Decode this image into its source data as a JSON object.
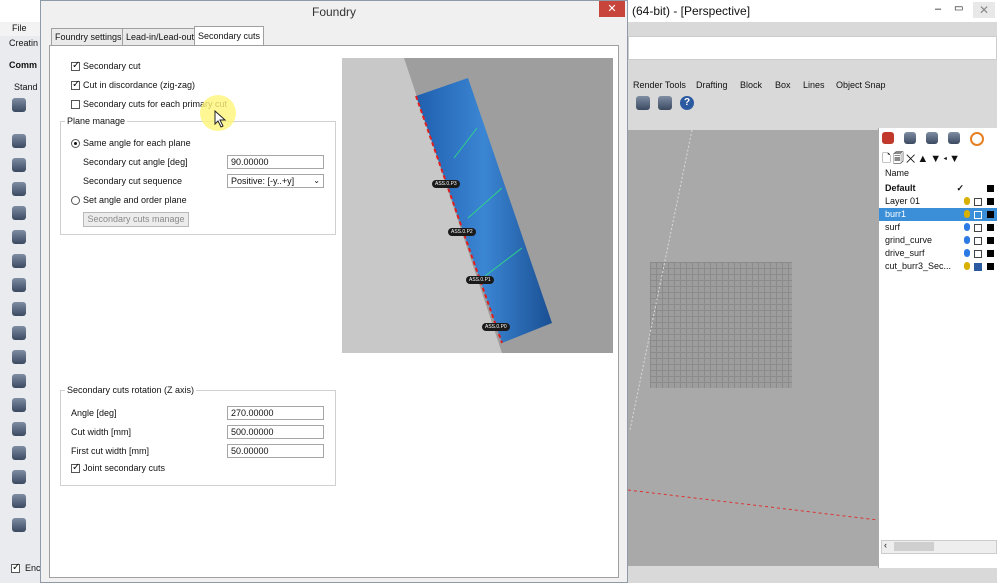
{
  "app": {
    "file_menu": "File",
    "left_truncated": [
      "Creatin",
      "Comm",
      "Stand",
      "Enc"
    ],
    "right_title": "(64-bit) - [Perspective]",
    "toolbar_tabs": [
      "Render Tools",
      "Drafting",
      "Block",
      "Box",
      "Lines",
      "Object Snap"
    ]
  },
  "layers": {
    "header": "Name",
    "items": [
      {
        "name": "Default",
        "checked": "✓",
        "color": "#000000"
      },
      {
        "name": "Layer 01",
        "color": "#000000"
      },
      {
        "name": "burr1",
        "color": "#000000",
        "selected": true
      },
      {
        "name": "surf",
        "color": "#000000"
      },
      {
        "name": "grind_curve",
        "color": "#000000"
      },
      {
        "name": "drive_surf",
        "color": "#000000"
      },
      {
        "name": "cut_burr3_Sec...",
        "color": "#000000"
      }
    ]
  },
  "dialog": {
    "title": "Foundry",
    "close": "✕",
    "tabs": [
      "Foundry settings",
      "Lead-in/Lead-out",
      "Secondary cuts"
    ],
    "options": {
      "secondary_cut": "Secondary cut",
      "cut_discordance": "Cut in discordance (zig-zag)",
      "cuts_each_primary": "Secondary cuts for each primary cut"
    },
    "plane_manage": {
      "title": "Plane manage",
      "same_angle": "Same angle for each plane",
      "angle_label": "Secondary cut angle [deg]",
      "angle_value": "90.00000",
      "sequence_label": "Secondary cut sequence",
      "sequence_value": "Positive: [-y..+y]",
      "set_angle_order": "Set angle and order plane",
      "manage_button": "Secondary cuts manage"
    },
    "rotation": {
      "title": "Secondary cuts rotation (Z axis)",
      "angle_label": "Angle [deg]",
      "angle_value": "270.00000",
      "cut_width_label": "Cut width [mm]",
      "cut_width_value": "500.00000",
      "first_cut_label": "First cut width [mm]",
      "first_cut_value": "50.00000",
      "joint_label": "Joint secondary cuts"
    },
    "preview_tags": [
      "ASS.0.P3",
      "ASS.0.P2",
      "ASS.0.P1",
      "ASS.0.P0"
    ]
  }
}
